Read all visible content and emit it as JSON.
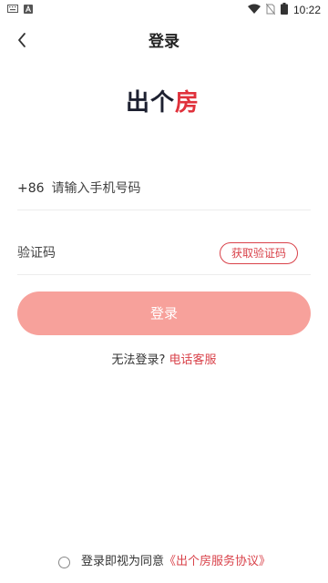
{
  "status_bar": {
    "time": "10:22",
    "left_icons": [
      "keyboard-icon",
      "a-badge-icon"
    ],
    "right_icons": [
      "wifi-icon",
      "no-sim-icon",
      "battery-icon"
    ]
  },
  "header": {
    "title": "登录",
    "back_icon": "chevron-left-icon"
  },
  "logo": {
    "part1": "出个",
    "part2": "房",
    "colors": {
      "dark": "#1d2030",
      "red": "#e0323c"
    }
  },
  "form": {
    "country_code": "+86",
    "phone_placeholder": "请输入手机号码",
    "code_placeholder": "验证码",
    "get_code_label": "获取验证码"
  },
  "login_button": {
    "label": "登录",
    "color": "#f7a19b"
  },
  "help": {
    "text": "无法登录?",
    "link": "电话客服"
  },
  "agreement": {
    "checked": false,
    "text": "登录即视为同意",
    "link": "《出个房服务协议》"
  },
  "accent_color": "#d9424a"
}
